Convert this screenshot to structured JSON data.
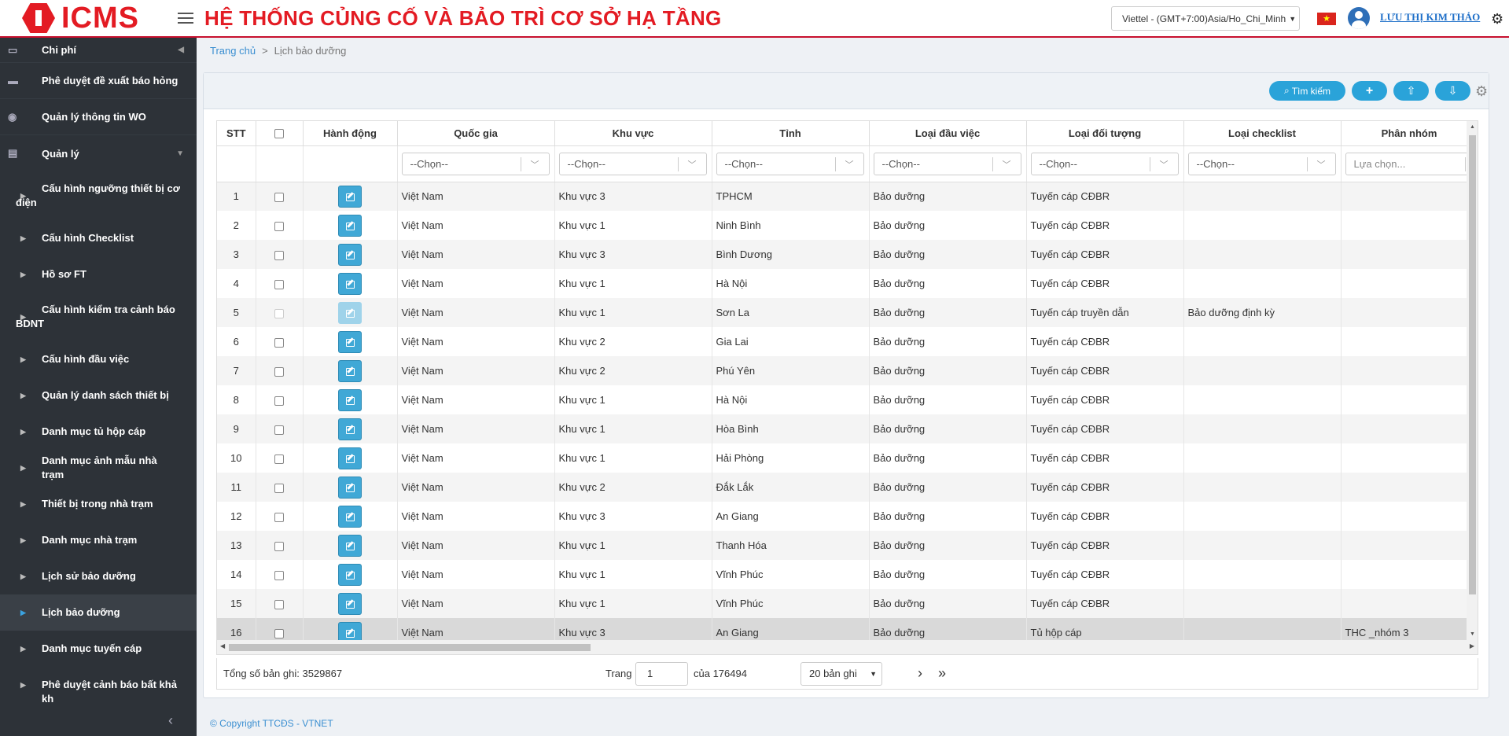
{
  "header": {
    "logo_text": "ICMS",
    "system_title": "HỆ THỐNG CỦNG CỐ VÀ BẢO TRÌ CƠ SỞ HẠ TẦNG",
    "timezone": "Viettel - (GMT+7:00)Asia/Ho_Chi_Minh",
    "flag_star": "★",
    "user_name": "LƯU THỊ KIM THẢO"
  },
  "sidebar": {
    "top_items": [
      {
        "label": "Chi phí"
      },
      {
        "label": "Phê duyệt đề xuất báo hỏng"
      },
      {
        "label": "Quản lý thông tin WO"
      },
      {
        "label": "Quản lý"
      }
    ],
    "sub_items": [
      {
        "label": "Cấu hình ngưỡng thiết bị cơ điện"
      },
      {
        "label": "Cấu hình Checklist"
      },
      {
        "label": "Hồ sơ FT"
      },
      {
        "label": "Cấu hình kiểm tra cảnh báo BDNT"
      },
      {
        "label": "Cấu hình đầu việc"
      },
      {
        "label": "Quản lý danh sách thiết bị"
      },
      {
        "label": "Danh mục tủ hộp cáp"
      },
      {
        "label": "Danh mục ảnh mẫu nhà trạm"
      },
      {
        "label": "Thiết bị trong nhà trạm"
      },
      {
        "label": "Danh mục nhà trạm"
      },
      {
        "label": "Lịch sử bảo dưỡng"
      },
      {
        "label": "Lịch bảo dưỡng"
      },
      {
        "label": "Danh mục tuyến cáp"
      },
      {
        "label": "Phê duyệt cảnh báo bất khả kh"
      }
    ]
  },
  "breadcrumb": {
    "home": "Trang chủ",
    "sep": ">",
    "current": "Lịch bảo dưỡng"
  },
  "toolbar": {
    "search_label": "Tìm kiếm",
    "add_label": "+",
    "upload_label": "⇧",
    "download_label": "⇩"
  },
  "table": {
    "headers": [
      "STT",
      "",
      "Hành động",
      "Quốc gia",
      "Khu vực",
      "Tỉnh",
      "Loại đầu việc",
      "Loại đối tượng",
      "Loại checklist",
      "Phân nhóm"
    ],
    "filter_placeholder": "--Chọn--",
    "filter_multi_placeholder": "Lựa chọn...",
    "rows": [
      {
        "stt": "1",
        "country": "Việt Nam",
        "region": "Khu vực 3",
        "province": "TPHCM",
        "task": "Bảo dưỡng",
        "object": "Tuyến cáp CĐBR",
        "checklist": "",
        "group": ""
      },
      {
        "stt": "2",
        "country": "Việt Nam",
        "region": "Khu vực 1",
        "province": "Ninh Bình",
        "task": "Bảo dưỡng",
        "object": "Tuyến cáp CĐBR",
        "checklist": "",
        "group": ""
      },
      {
        "stt": "3",
        "country": "Việt Nam",
        "region": "Khu vực 3",
        "province": "Bình Dương",
        "task": "Bảo dưỡng",
        "object": "Tuyến cáp CĐBR",
        "checklist": "",
        "group": ""
      },
      {
        "stt": "4",
        "country": "Việt Nam",
        "region": "Khu vực 1",
        "province": "Hà Nội",
        "task": "Bảo dưỡng",
        "object": "Tuyến cáp CĐBR",
        "checklist": "",
        "group": ""
      },
      {
        "stt": "5",
        "country": "Việt Nam",
        "region": "Khu vực 1",
        "province": "Sơn La",
        "task": "Bảo dưỡng",
        "object": "Tuyến cáp truyền dẫn",
        "checklist": "Bảo dưỡng định kỳ",
        "group": "",
        "disabled": true
      },
      {
        "stt": "6",
        "country": "Việt Nam",
        "region": "Khu vực 2",
        "province": "Gia Lai",
        "task": "Bảo dưỡng",
        "object": "Tuyến cáp CĐBR",
        "checklist": "",
        "group": ""
      },
      {
        "stt": "7",
        "country": "Việt Nam",
        "region": "Khu vực 2",
        "province": "Phú Yên",
        "task": "Bảo dưỡng",
        "object": "Tuyến cáp CĐBR",
        "checklist": "",
        "group": ""
      },
      {
        "stt": "8",
        "country": "Việt Nam",
        "region": "Khu vực 1",
        "province": "Hà Nội",
        "task": "Bảo dưỡng",
        "object": "Tuyến cáp CĐBR",
        "checklist": "",
        "group": ""
      },
      {
        "stt": "9",
        "country": "Việt Nam",
        "region": "Khu vực 1",
        "province": "Hòa Bình",
        "task": "Bảo dưỡng",
        "object": "Tuyến cáp CĐBR",
        "checklist": "",
        "group": ""
      },
      {
        "stt": "10",
        "country": "Việt Nam",
        "region": "Khu vực 1",
        "province": "Hải Phòng",
        "task": "Bảo dưỡng",
        "object": "Tuyến cáp CĐBR",
        "checklist": "",
        "group": ""
      },
      {
        "stt": "11",
        "country": "Việt Nam",
        "region": "Khu vực 2",
        "province": "Đắk Lắk",
        "task": "Bảo dưỡng",
        "object": "Tuyến cáp CĐBR",
        "checklist": "",
        "group": ""
      },
      {
        "stt": "12",
        "country": "Việt Nam",
        "region": "Khu vực 3",
        "province": "An Giang",
        "task": "Bảo dưỡng",
        "object": "Tuyến cáp CĐBR",
        "checklist": "",
        "group": ""
      },
      {
        "stt": "13",
        "country": "Việt Nam",
        "region": "Khu vực 1",
        "province": "Thanh Hóa",
        "task": "Bảo dưỡng",
        "object": "Tuyến cáp CĐBR",
        "checklist": "",
        "group": ""
      },
      {
        "stt": "14",
        "country": "Việt Nam",
        "region": "Khu vực 1",
        "province": "Vĩnh Phúc",
        "task": "Bảo dưỡng",
        "object": "Tuyến cáp CĐBR",
        "checklist": "",
        "group": ""
      },
      {
        "stt": "15",
        "country": "Việt Nam",
        "region": "Khu vực 1",
        "province": "Vĩnh Phúc",
        "task": "Bảo dưỡng",
        "object": "Tuyến cáp CĐBR",
        "checklist": "",
        "group": ""
      },
      {
        "stt": "16",
        "country": "Việt Nam",
        "region": "Khu vực 3",
        "province": "An Giang",
        "task": "Bảo dưỡng",
        "object": "Tủ hộp cáp",
        "checklist": "",
        "group": "THC _nhóm 3",
        "selected": true
      }
    ]
  },
  "pagination": {
    "total_label": "Tổng số bản ghi: 3529867",
    "page_label": "Trang",
    "page_value": "1",
    "of_label": "của 176494",
    "page_size": "20 bản ghi",
    "next": "›",
    "last": "»"
  },
  "footer": {
    "copyright": "© Copyright TTCĐS - VTNET"
  },
  "colors": {
    "brand_red": "#e31b23",
    "sidebar_bg": "#2d3238",
    "accent_blue": "#2aa3d9"
  }
}
